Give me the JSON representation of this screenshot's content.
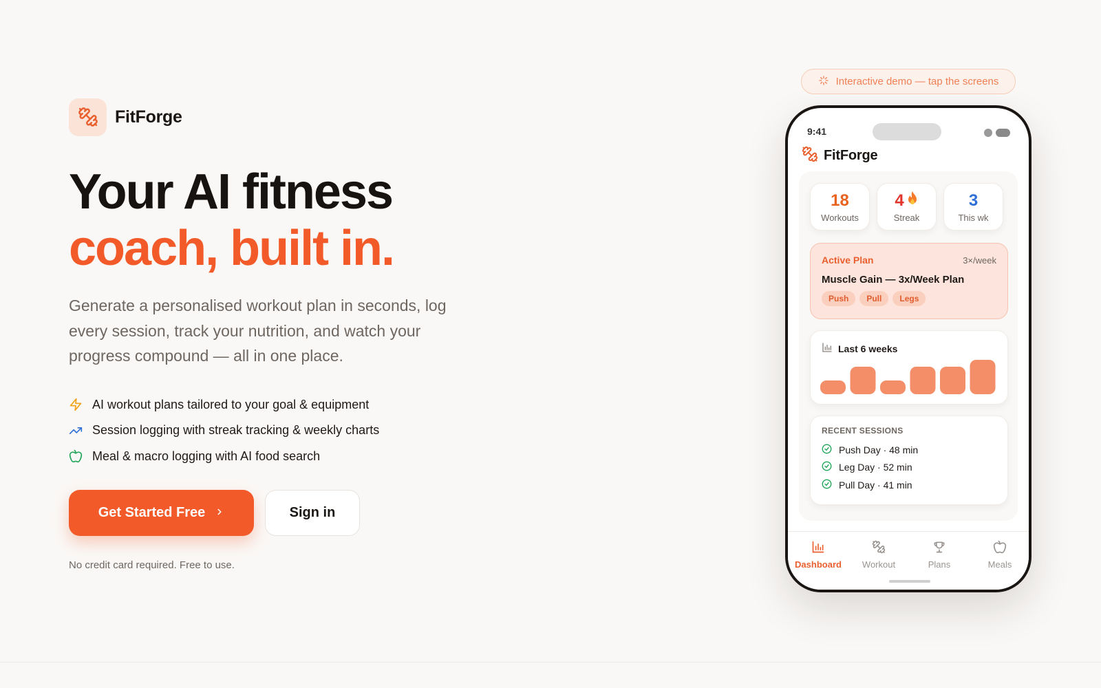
{
  "brand": {
    "name": "FitForge",
    "icon": "dumbbell-icon"
  },
  "hero": {
    "headline_line1": "Your AI fitness",
    "headline_line2": "coach, built in.",
    "subheadline": "Generate a personalised workout plan in seconds, log every session, track your nutrition, and watch your progress compound — all in one place.",
    "features": [
      {
        "icon": "lightning-icon",
        "text": "AI workout plans tailored to your goal & equipment"
      },
      {
        "icon": "trending-up-icon",
        "text": "Session logging with streak tracking & weekly charts"
      },
      {
        "icon": "apple-icon",
        "text": "Meal & macro logging with AI food search"
      }
    ],
    "cta_primary": "Get Started Free",
    "cta_secondary": "Sign in",
    "note": "No credit card required. Free to use."
  },
  "demo_pill": {
    "text": "Interactive demo — tap the screens",
    "icon": "sparkle-icon"
  },
  "phone": {
    "status_time": "9:41",
    "app_name": "FitForge",
    "stats": [
      {
        "value": "18",
        "label": "Workouts",
        "color": "#e8631f"
      },
      {
        "value": "4",
        "label": "Streak",
        "color": "#e2362c"
      },
      {
        "value": "3",
        "label": "This wk",
        "color": "#2f6fd6"
      }
    ],
    "active_plan": {
      "tag": "Active Plan",
      "frequency": "3×/week",
      "title": "Muscle Gain — 3x/Week Plan",
      "chips": [
        "Push",
        "Pull",
        "Legs"
      ]
    },
    "weekly_chart": {
      "title": "Last 6 weeks",
      "values": [
        2,
        4,
        2,
        4,
        4,
        5
      ]
    },
    "recent_sessions": {
      "title": "RECENT SESSIONS",
      "items": [
        "Push Day · 48 min",
        "Leg Day · 52 min",
        "Pull Day · 41 min"
      ]
    },
    "tabs": [
      {
        "label": "Dashboard",
        "icon": "bar-chart-icon",
        "active": true
      },
      {
        "label": "Workout",
        "icon": "dumbbell-icon",
        "active": false
      },
      {
        "label": "Plans",
        "icon": "trophy-icon",
        "active": false
      },
      {
        "label": "Meals",
        "icon": "apple-icon",
        "active": false
      }
    ]
  },
  "colors": {
    "accent": "#f25b29",
    "background": "#faf8f6",
    "success": "#22a55a"
  }
}
